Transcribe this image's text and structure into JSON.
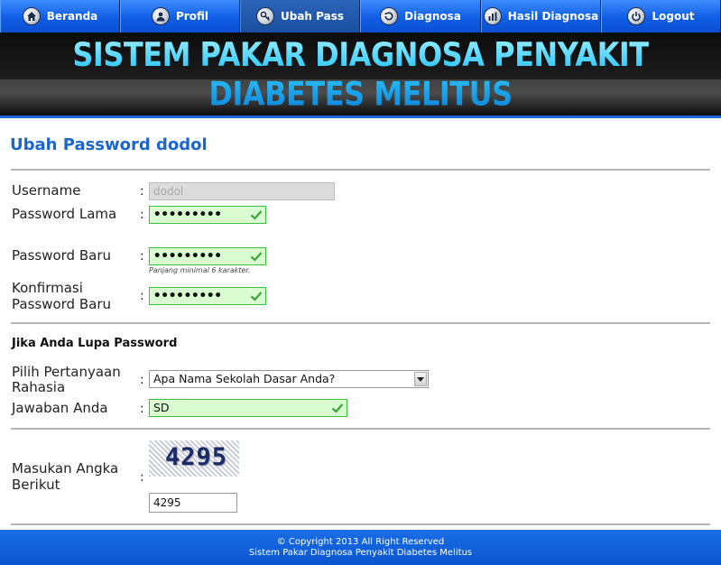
{
  "nav": {
    "items": [
      {
        "label": "Beranda",
        "icon": "home-icon"
      },
      {
        "label": "Profil",
        "icon": "user-icon"
      },
      {
        "label": "Ubah Pass",
        "icon": "key-icon",
        "active": true
      },
      {
        "label": "Diagnosa",
        "icon": "refresh-icon"
      },
      {
        "label": "Hasil Diagnosa",
        "icon": "bar-chart-icon"
      },
      {
        "label": "Logout",
        "icon": "power-icon"
      }
    ]
  },
  "banner": {
    "title": "SISTEM PAKAR DIAGNOSA PENYAKIT DIABETES MELITUS"
  },
  "page": {
    "title": "Ubah Password dodol"
  },
  "form": {
    "username_label": "Username",
    "username_value": "dodol",
    "old_password_label": "Password Lama",
    "old_password_value": "•••••••••",
    "new_password_label": "Password Baru",
    "new_password_value": "•••••••••",
    "new_password_hint": "Panjang minimal 6 karakter.",
    "confirm_password_label_1": "Konfirmasi",
    "confirm_password_label_2": "Password Baru",
    "confirm_password_value": "•••••••••",
    "colon": ":",
    "forgot_heading": "Jika Anda Lupa Password",
    "question_label_1": "Pilih Pertanyaan",
    "question_label_2": "Rahasia",
    "question_selected": "Apa Nama Sekolah Dasar Anda?",
    "answer_label": "Jawaban Anda",
    "answer_value": "SD",
    "captcha_label_1": "Masukan Angka",
    "captcha_label_2": "Berikut",
    "captcha_image_text": "4295",
    "captcha_value": "4295"
  },
  "footer": {
    "line1": "© Copyright 2013 All Right Reserved",
    "line2": "Sistem Pakar Diagnosa Penyakit Diabetes Melitus"
  },
  "colors": {
    "nav_blue": "#0f5ee6",
    "title_blue": "#1a66cc",
    "valid_green_border": "#3cc13c",
    "valid_green_fill": "#d9fcd1",
    "footer_blue": "#0b55cf"
  }
}
